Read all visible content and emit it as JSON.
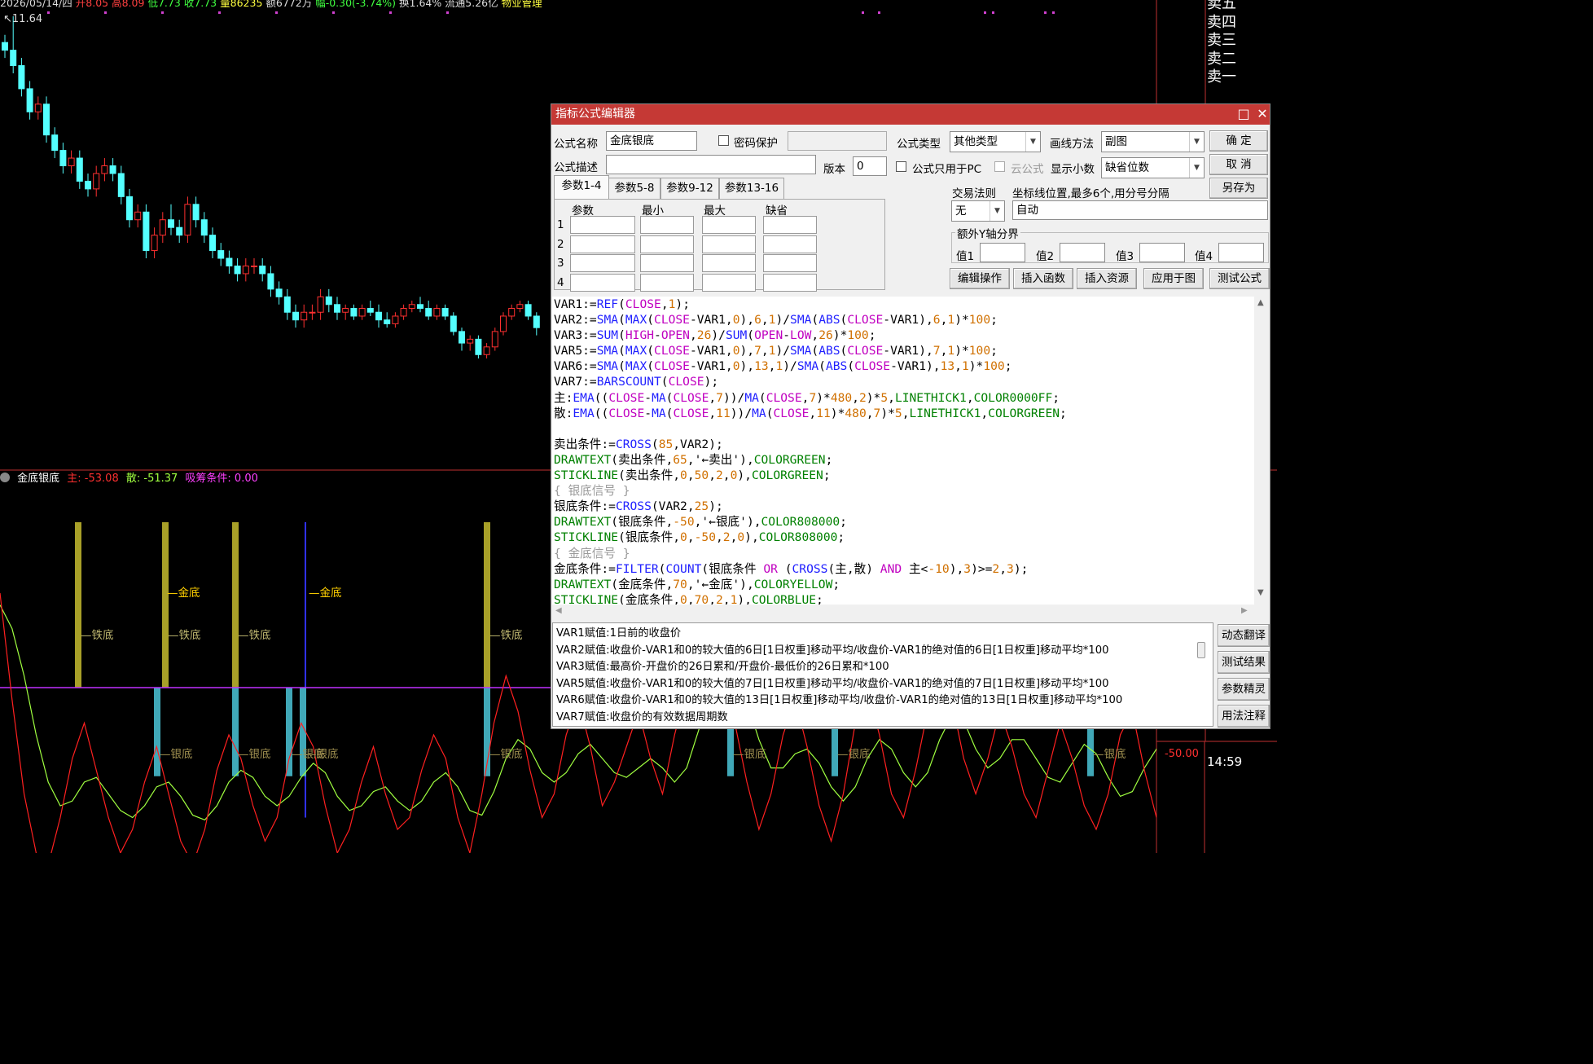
{
  "header": {
    "date": "2026/05/14/四",
    "open": "开8.05",
    "high": "高8.09",
    "low": "低7.73",
    "close": "收7.73",
    "volume": "量86235",
    "amount": "额6772万",
    "change": "幅-0.30(-3.74%)",
    "turnover": "换1.64%",
    "float_cap": "流通5.26亿",
    "sector": "物业管理",
    "price_label": "11.64"
  },
  "order_book": {
    "items": [
      "卖五",
      "卖四",
      "卖三",
      "卖二",
      "卖一"
    ]
  },
  "indicator_legend": {
    "name": "金底银底",
    "main": "主: -53.08",
    "scatter": "散: -51.37",
    "absorb": "吸筹条件: 0.00"
  },
  "axis": {
    "sub_level": "-50.00",
    "time": "14:59"
  },
  "chart_labels": {
    "iron": "铁底",
    "silver": "银底",
    "gold": "金底",
    "sold": "←卖出"
  },
  "colors": {
    "up_candle": "#ff3030",
    "down_candle": "#54ffff",
    "main_line": "#ff2020",
    "scatter_line": "#a0ff40",
    "gold_stick": "#a8a028",
    "silver_stick": "#40a8b8",
    "zero_line": "#c030ff",
    "dialog_title": "#c53935"
  },
  "dialog": {
    "title": "指标公式编辑器",
    "maximize_icon": "□",
    "close_icon": "✕",
    "name_label": "公式名称",
    "name_value": "金底银底",
    "password_label": "密码保护",
    "type_label": "公式类型",
    "type_value": "其他类型",
    "draw_label": "画线方法",
    "draw_value": "副图",
    "ok": "确  定",
    "cancel": "取  消",
    "save_as": "另存为",
    "desc_label": "公式描述",
    "desc_value": "",
    "version_label": "版本",
    "version_value": "0",
    "pc_only_label": "公式只用于PC",
    "cloud_label": "云公式",
    "decimals_label": "显示小数",
    "decimals_value": "缺省位数",
    "trade_rule_label": "交易法则",
    "trade_rule_value": "无",
    "coord_label": "坐标线位置,最多6个,用分号分隔",
    "coord_value": "自动",
    "extra_y_label": "额外Y轴分界",
    "values": [
      "值1",
      "值2",
      "值3",
      "值4"
    ],
    "tabs": [
      "参数1-4",
      "参数5-8",
      "参数9-12",
      "参数13-16"
    ],
    "param_headers": [
      "参数",
      "最小",
      "最大",
      "缺省"
    ],
    "param_rows": [
      "1",
      "2",
      "3",
      "4"
    ],
    "buttons": [
      "编辑操作",
      "插入函数",
      "插入资源",
      "应用于图",
      "测试公式"
    ],
    "side_buttons": [
      "动态翻译",
      "测试结果",
      "参数精灵",
      "用法注释"
    ]
  },
  "translation_lines": [
    "VAR1赋值:1日前的收盘价",
    "VAR2赋值:收盘价-VAR1和0的较大值的6日[1日权重]移动平均/收盘价-VAR1的绝对值的6日[1日权重]移动平均*100",
    "VAR3赋值:最高价-开盘价的26日累和/开盘价-最低价的26日累和*100",
    "VAR5赋值:收盘价-VAR1和0的较大值的7日[1日权重]移动平均/收盘价-VAR1的绝对值的7日[1日权重]移动平均*100",
    "VAR6赋值:收盘价-VAR1和0的较大值的13日[1日权重]移动平均/收盘价-VAR1的绝对值的13日[1日权重]移动平均*100",
    "VAR7赋值:收盘价的有效数据周期数"
  ],
  "code_lines": [
    [
      [
        "VAR1:=",
        ""
      ],
      [
        "REF",
        "f"
      ],
      [
        "(",
        ""
      ],
      [
        "CLOSE",
        "k"
      ],
      [
        ",",
        ""
      ],
      [
        "1",
        "n"
      ],
      [
        ");",
        ""
      ]
    ],
    [
      [
        "VAR2:=",
        ""
      ],
      [
        "SMA",
        "f"
      ],
      [
        "(",
        ""
      ],
      [
        "MAX",
        "f"
      ],
      [
        "(",
        ""
      ],
      [
        "CLOSE",
        "k"
      ],
      [
        "-VAR1,",
        ""
      ],
      [
        "0",
        "n"
      ],
      [
        "),",
        ""
      ],
      [
        "6",
        "n"
      ],
      [
        ",",
        ""
      ],
      [
        "1",
        "n"
      ],
      [
        ")/",
        ""
      ],
      [
        "SMA",
        "f"
      ],
      [
        "(",
        ""
      ],
      [
        "ABS",
        "f"
      ],
      [
        "(",
        ""
      ],
      [
        "CLOSE",
        "k"
      ],
      [
        "-VAR1),",
        ""
      ],
      [
        "6",
        "n"
      ],
      [
        ",",
        ""
      ],
      [
        "1",
        "n"
      ],
      [
        ")*",
        ""
      ],
      [
        "100",
        "n"
      ],
      [
        ";",
        ""
      ]
    ],
    [
      [
        "VAR3:=",
        ""
      ],
      [
        "SUM",
        "f"
      ],
      [
        "(",
        ""
      ],
      [
        "HIGH",
        "k"
      ],
      [
        "-",
        ""
      ],
      [
        "OPEN",
        "k"
      ],
      [
        ",",
        ""
      ],
      [
        "26",
        "n"
      ],
      [
        ")/",
        ""
      ],
      [
        "SUM",
        "f"
      ],
      [
        "(",
        ""
      ],
      [
        "OPEN",
        "k"
      ],
      [
        "-",
        ""
      ],
      [
        "LOW",
        "k"
      ],
      [
        ",",
        ""
      ],
      [
        "26",
        "n"
      ],
      [
        ")*",
        ""
      ],
      [
        "100",
        "n"
      ],
      [
        ";",
        ""
      ]
    ],
    [
      [
        "VAR5:=",
        ""
      ],
      [
        "SMA",
        "f"
      ],
      [
        "(",
        ""
      ],
      [
        "MAX",
        "f"
      ],
      [
        "(",
        ""
      ],
      [
        "CLOSE",
        "k"
      ],
      [
        "-VAR1,",
        ""
      ],
      [
        "0",
        "n"
      ],
      [
        "),",
        ""
      ],
      [
        "7",
        "n"
      ],
      [
        ",",
        ""
      ],
      [
        "1",
        "n"
      ],
      [
        ")/",
        ""
      ],
      [
        "SMA",
        "f"
      ],
      [
        "(",
        ""
      ],
      [
        "ABS",
        "f"
      ],
      [
        "(",
        ""
      ],
      [
        "CLOSE",
        "k"
      ],
      [
        "-VAR1),",
        ""
      ],
      [
        "7",
        "n"
      ],
      [
        ",",
        ""
      ],
      [
        "1",
        "n"
      ],
      [
        ")*",
        ""
      ],
      [
        "100",
        "n"
      ],
      [
        ";",
        ""
      ]
    ],
    [
      [
        "VAR6:=",
        ""
      ],
      [
        "SMA",
        "f"
      ],
      [
        "(",
        ""
      ],
      [
        "MAX",
        "f"
      ],
      [
        "(",
        ""
      ],
      [
        "CLOSE",
        "k"
      ],
      [
        "-VAR1,",
        ""
      ],
      [
        "0",
        "n"
      ],
      [
        "),",
        ""
      ],
      [
        "13",
        "n"
      ],
      [
        ",",
        ""
      ],
      [
        "1",
        "n"
      ],
      [
        ")/",
        ""
      ],
      [
        "SMA",
        "f"
      ],
      [
        "(",
        ""
      ],
      [
        "ABS",
        "f"
      ],
      [
        "(",
        ""
      ],
      [
        "CLOSE",
        "k"
      ],
      [
        "-VAR1),",
        ""
      ],
      [
        "13",
        "n"
      ],
      [
        ",",
        ""
      ],
      [
        "1",
        "n"
      ],
      [
        ")*",
        ""
      ],
      [
        "100",
        "n"
      ],
      [
        ";",
        ""
      ]
    ],
    [
      [
        "VAR7:=",
        ""
      ],
      [
        "BARSCOUNT",
        "f"
      ],
      [
        "(",
        ""
      ],
      [
        "CLOSE",
        "k"
      ],
      [
        ");",
        ""
      ]
    ],
    [
      [
        "主:",
        ""
      ],
      [
        "EMA",
        "f"
      ],
      [
        "((",
        ""
      ],
      [
        "CLOSE",
        "k"
      ],
      [
        "-",
        ""
      ],
      [
        "MA",
        "f"
      ],
      [
        "(",
        ""
      ],
      [
        "CLOSE",
        "k"
      ],
      [
        ",",
        ""
      ],
      [
        "7",
        "n"
      ],
      [
        "))/",
        ""
      ],
      [
        "MA",
        "f"
      ],
      [
        "(",
        ""
      ],
      [
        "CLOSE",
        "k"
      ],
      [
        ",",
        ""
      ],
      [
        "7",
        "n"
      ],
      [
        ")*",
        ""
      ],
      [
        "480",
        "n"
      ],
      [
        ",",
        ""
      ],
      [
        "2",
        "n"
      ],
      [
        ")*",
        ""
      ],
      [
        "5",
        "n"
      ],
      [
        ",",
        ""
      ],
      [
        "LINETHICK1",
        "g"
      ],
      [
        ",",
        ""
      ],
      [
        "COLOR0000FF",
        "g"
      ],
      [
        ";",
        ""
      ]
    ],
    [
      [
        "散:",
        ""
      ],
      [
        "EMA",
        "f"
      ],
      [
        "((",
        ""
      ],
      [
        "CLOSE",
        "k"
      ],
      [
        "-",
        ""
      ],
      [
        "MA",
        "f"
      ],
      [
        "(",
        ""
      ],
      [
        "CLOSE",
        "k"
      ],
      [
        ",",
        ""
      ],
      [
        "11",
        "n"
      ],
      [
        "))/",
        ""
      ],
      [
        "MA",
        "f"
      ],
      [
        "(",
        ""
      ],
      [
        "CLOSE",
        "k"
      ],
      [
        ",",
        ""
      ],
      [
        "11",
        "n"
      ],
      [
        ")*",
        ""
      ],
      [
        "480",
        "n"
      ],
      [
        ",",
        ""
      ],
      [
        "7",
        "n"
      ],
      [
        ")*",
        ""
      ],
      [
        "5",
        "n"
      ],
      [
        ",",
        ""
      ],
      [
        "LINETHICK1",
        "g"
      ],
      [
        ",",
        ""
      ],
      [
        "COLORGREEN",
        "g"
      ],
      [
        ";",
        ""
      ]
    ],
    [
      [
        "",
        ""
      ]
    ],
    [
      [
        "卖出条件:=",
        ""
      ],
      [
        "CROSS",
        "f"
      ],
      [
        "(",
        ""
      ],
      [
        "85",
        "n"
      ],
      [
        ",VAR2);",
        ""
      ]
    ],
    [
      [
        "DRAWTEXT",
        "g"
      ],
      [
        "(卖出条件,",
        ""
      ],
      [
        "65",
        "n"
      ],
      [
        ",'←卖出'),",
        ""
      ],
      [
        "COLORGREEN",
        "g"
      ],
      [
        ";",
        ""
      ]
    ],
    [
      [
        "STICKLINE",
        "g"
      ],
      [
        "(卖出条件,",
        ""
      ],
      [
        "0",
        "n"
      ],
      [
        ",",
        ""
      ],
      [
        "50",
        "n"
      ],
      [
        ",",
        ""
      ],
      [
        "2",
        "n"
      ],
      [
        ",",
        ""
      ],
      [
        "0",
        "n"
      ],
      [
        "),",
        ""
      ],
      [
        "COLORGREEN",
        "g"
      ],
      [
        ";",
        ""
      ]
    ],
    [
      [
        "{ 银底信号 }",
        "c"
      ]
    ],
    [
      [
        "银底条件:=",
        ""
      ],
      [
        "CROSS",
        "f"
      ],
      [
        "(VAR2,",
        ""
      ],
      [
        "25",
        "n"
      ],
      [
        ");",
        ""
      ]
    ],
    [
      [
        "DRAWTEXT",
        "g"
      ],
      [
        "(银底条件,",
        ""
      ],
      [
        "-50",
        "n"
      ],
      [
        ",'←银底'),",
        ""
      ],
      [
        "COLOR808000",
        "g"
      ],
      [
        ";",
        ""
      ]
    ],
    [
      [
        "STICKLINE",
        "g"
      ],
      [
        "(银底条件,",
        ""
      ],
      [
        "0",
        "n"
      ],
      [
        ",",
        ""
      ],
      [
        "-50",
        "n"
      ],
      [
        ",",
        ""
      ],
      [
        "2",
        "n"
      ],
      [
        ",",
        ""
      ],
      [
        "0",
        "n"
      ],
      [
        "),",
        ""
      ],
      [
        "COLOR808000",
        "g"
      ],
      [
        ";",
        ""
      ]
    ],
    [
      [
        "{ 金底信号 }",
        "c"
      ]
    ],
    [
      [
        "金底条件:=",
        ""
      ],
      [
        "FILTER",
        "f"
      ],
      [
        "(",
        ""
      ],
      [
        "COUNT",
        "f"
      ],
      [
        "(银底条件 ",
        ""
      ],
      [
        "OR",
        "k"
      ],
      [
        " (",
        ""
      ],
      [
        "CROSS",
        "f"
      ],
      [
        "(主,散) ",
        ""
      ],
      [
        "AND",
        "k"
      ],
      [
        " 主<",
        ""
      ],
      [
        "-10",
        "n"
      ],
      [
        "),",
        ""
      ],
      [
        "3",
        "n"
      ],
      [
        ")>=",
        ""
      ],
      [
        "2",
        "n"
      ],
      [
        ",",
        ""
      ],
      [
        "3",
        "n"
      ],
      [
        ");",
        ""
      ]
    ],
    [
      [
        "DRAWTEXT",
        "g"
      ],
      [
        "(金底条件,",
        ""
      ],
      [
        "70",
        "n"
      ],
      [
        ",'←金底'),",
        ""
      ],
      [
        "COLORYELLOW",
        "g"
      ],
      [
        ";",
        ""
      ]
    ],
    [
      [
        "STICKLINE",
        "g"
      ],
      [
        "(金底条件,",
        ""
      ],
      [
        "0",
        "n"
      ],
      [
        ",",
        ""
      ],
      [
        "70",
        "n"
      ],
      [
        ",",
        ""
      ],
      [
        "2",
        "n"
      ],
      [
        ",",
        ""
      ],
      [
        "1",
        "n"
      ],
      [
        "),",
        ""
      ],
      [
        "COLORBLUE",
        "g"
      ],
      [
        ";",
        ""
      ]
    ]
  ],
  "candles": [
    [
      11.3,
      11.4,
      11.1,
      11.2
    ],
    [
      11.2,
      11.64,
      10.9,
      11.0
    ],
    [
      11.0,
      11.1,
      10.6,
      10.7
    ],
    [
      10.7,
      10.8,
      10.3,
      10.4
    ],
    [
      10.4,
      10.6,
      10.3,
      10.5
    ],
    [
      10.5,
      10.6,
      10.0,
      10.1
    ],
    [
      10.1,
      10.2,
      9.8,
      9.9
    ],
    [
      9.9,
      10.0,
      9.6,
      9.7
    ],
    [
      9.7,
      9.9,
      9.6,
      9.8
    ],
    [
      9.8,
      9.9,
      9.4,
      9.5
    ],
    [
      9.5,
      9.6,
      9.3,
      9.4
    ],
    [
      9.4,
      9.7,
      9.3,
      9.6
    ],
    [
      9.6,
      9.8,
      9.5,
      9.7
    ],
    [
      9.7,
      9.8,
      9.5,
      9.6
    ],
    [
      9.6,
      9.7,
      9.2,
      9.3
    ],
    [
      9.3,
      9.4,
      8.9,
      9.0
    ],
    [
      9.0,
      9.2,
      8.9,
      9.1
    ],
    [
      9.1,
      9.2,
      8.5,
      8.6
    ],
    [
      8.6,
      8.9,
      8.5,
      8.8
    ],
    [
      8.8,
      9.1,
      8.7,
      9.0
    ],
    [
      9.0,
      9.2,
      8.8,
      8.9
    ],
    [
      8.9,
      9.0,
      8.7,
      8.8
    ],
    [
      8.8,
      9.3,
      8.7,
      9.2
    ],
    [
      9.2,
      9.3,
      8.9,
      9.0
    ],
    [
      9.0,
      9.1,
      8.7,
      8.8
    ],
    [
      8.8,
      8.9,
      8.5,
      8.6
    ],
    [
      8.6,
      8.7,
      8.4,
      8.5
    ],
    [
      8.5,
      8.6,
      8.3,
      8.4
    ],
    [
      8.4,
      8.5,
      8.2,
      8.3
    ],
    [
      8.3,
      8.5,
      8.2,
      8.4
    ],
    [
      8.4,
      8.5,
      8.3,
      8.4
    ],
    [
      8.4,
      8.5,
      8.2,
      8.3
    ],
    [
      8.3,
      8.4,
      8.0,
      8.1
    ],
    [
      8.1,
      8.2,
      7.9,
      8.0
    ],
    [
      8.0,
      8.1,
      7.7,
      7.8
    ],
    [
      7.8,
      7.9,
      7.6,
      7.7
    ],
    [
      7.7,
      7.9,
      7.6,
      7.8
    ],
    [
      7.8,
      7.9,
      7.7,
      7.8
    ],
    [
      7.8,
      8.1,
      7.7,
      8.0
    ],
    [
      8.0,
      8.1,
      7.8,
      7.9
    ],
    [
      7.9,
      8.0,
      7.7,
      7.8
    ],
    [
      7.8,
      7.9,
      7.7,
      7.85
    ],
    [
      7.85,
      7.9,
      7.7,
      7.75
    ],
    [
      7.75,
      7.9,
      7.7,
      7.85
    ],
    [
      7.85,
      7.95,
      7.75,
      7.8
    ],
    [
      7.8,
      7.9,
      7.6,
      7.7
    ],
    [
      7.7,
      7.8,
      7.6,
      7.65
    ],
    [
      7.65,
      7.8,
      7.6,
      7.75
    ],
    [
      7.75,
      7.9,
      7.7,
      7.85
    ],
    [
      7.85,
      7.95,
      7.8,
      7.9
    ],
    [
      7.9,
      8.0,
      7.8,
      7.85
    ],
    [
      7.85,
      7.95,
      7.7,
      7.75
    ],
    [
      7.75,
      7.9,
      7.7,
      7.85
    ],
    [
      7.85,
      7.9,
      7.7,
      7.75
    ],
    [
      7.75,
      7.8,
      7.5,
      7.55
    ],
    [
      7.55,
      7.6,
      7.3,
      7.4
    ],
    [
      7.4,
      7.5,
      7.3,
      7.45
    ],
    [
      7.45,
      7.5,
      7.2,
      7.25
    ],
    [
      7.25,
      7.4,
      7.2,
      7.35
    ],
    [
      7.35,
      7.6,
      7.3,
      7.55
    ],
    [
      7.55,
      7.8,
      7.5,
      7.75
    ],
    [
      7.75,
      7.9,
      7.7,
      7.85
    ],
    [
      7.85,
      7.95,
      7.8,
      7.9
    ],
    [
      7.9,
      7.95,
      7.7,
      7.75
    ],
    [
      7.75,
      7.8,
      7.5,
      7.6
    ]
  ],
  "main_line": [
    40,
    -5,
    -45,
    -70,
    -75,
    -55,
    -30,
    -15,
    -35,
    -55,
    -70,
    -60,
    -40,
    -25,
    -45,
    -65,
    -75,
    -60,
    -35,
    -20,
    -30,
    -50,
    -65,
    -55,
    -30,
    -15,
    -25,
    -50,
    -70,
    -60,
    -40,
    -25,
    -45,
    -60,
    -55,
    -35,
    -20,
    -30,
    -55,
    -70,
    -45,
    -15,
    5,
    -10,
    -35,
    -55,
    -45,
    -20,
    -5,
    -25,
    -50,
    -40,
    -25,
    -10,
    -30,
    -45,
    -20,
    0,
    25,
    40,
    15,
    -15,
    -40,
    -60,
    -45,
    -20,
    -5,
    -25,
    -50,
    -65,
    -45,
    -15,
    0,
    -20,
    -45,
    -55,
    -35,
    -10,
    10,
    -5,
    -30,
    -45,
    -30,
    -10,
    -25,
    -45,
    -55,
    -35,
    -15,
    -30,
    -50,
    -60,
    -45,
    -20,
    -10,
    -35,
    -55
  ],
  "scatter_line": [
    35,
    25,
    5,
    -20,
    -40,
    -50,
    -48,
    -40,
    -38,
    -45,
    -52,
    -55,
    -50,
    -42,
    -40,
    -46,
    -54,
    -56,
    -50,
    -40,
    -35,
    -38,
    -46,
    -50,
    -46,
    -38,
    -32,
    -36,
    -46,
    -52,
    -50,
    -44,
    -42,
    -48,
    -52,
    -48,
    -40,
    -36,
    -42,
    -52,
    -54,
    -44,
    -30,
    -22,
    -26,
    -36,
    -40,
    -36,
    -28,
    -24,
    -30,
    -36,
    -38,
    -34,
    -30,
    -34,
    -40,
    -34,
    -18,
    -2,
    10,
    6,
    -6,
    -22,
    -34,
    -34,
    -28,
    -26,
    -32,
    -42,
    -48,
    -42,
    -30,
    -22,
    -26,
    -36,
    -42,
    -36,
    -22,
    -12,
    -14,
    -26,
    -34,
    -30,
    -22,
    -22,
    -30,
    -38,
    -40,
    -32,
    -24,
    -28,
    -38,
    -46,
    -44,
    -34,
    -26,
    -28,
    -38
  ],
  "signals": {
    "iron": [
      96,
      203,
      289,
      598
    ],
    "gold": [
      203,
      377
    ],
    "silver": [
      193,
      289,
      355,
      372,
      598,
      897,
      1025,
      1339
    ]
  }
}
